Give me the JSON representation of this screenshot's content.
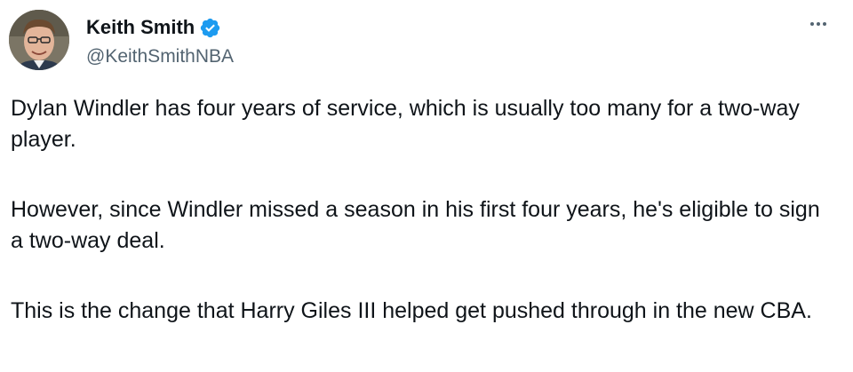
{
  "author": {
    "display_name": "Keith Smith",
    "handle": "@KeithSmithNBA",
    "verified": true,
    "verified_color": "#1d9bf0"
  },
  "menu": {
    "icon": "more-horizontal-icon"
  },
  "tweet": {
    "paragraphs": [
      "Dylan Windler has four years of service, which is usually too many for a two-way player.",
      "However, since Windler missed a season in his first four years, he's eligible to sign a two-way deal.",
      "This is the change that Harry Giles III helped get pushed through in the new CBA."
    ]
  },
  "colors": {
    "text": "#0f1419",
    "secondary": "#536471"
  }
}
